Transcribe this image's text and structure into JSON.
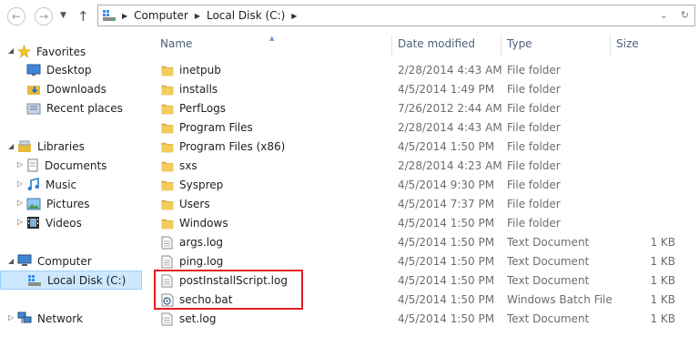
{
  "address": {
    "crumbs": [
      "Computer",
      "Local Disk (C:)"
    ]
  },
  "nav": {
    "favorites": "Favorites",
    "desktop": "Desktop",
    "downloads": "Downloads",
    "recent": "Recent places",
    "libraries": "Libraries",
    "documents": "Documents",
    "music": "Music",
    "pictures": "Pictures",
    "videos": "Videos",
    "computer": "Computer",
    "local_disk": "Local Disk (C:)",
    "network": "Network"
  },
  "columns": {
    "name": "Name",
    "date": "Date modified",
    "type": "Type",
    "size": "Size"
  },
  "files": [
    {
      "name": "inetpub",
      "date": "2/28/2014 4:43 AM",
      "type": "File folder",
      "size": "",
      "icon": "folder-icon"
    },
    {
      "name": "installs",
      "date": "4/5/2014 1:49 PM",
      "type": "File folder",
      "size": "",
      "icon": "folder-icon"
    },
    {
      "name": "PerfLogs",
      "date": "7/26/2012 2:44 AM",
      "type": "File folder",
      "size": "",
      "icon": "folder-icon"
    },
    {
      "name": "Program Files",
      "date": "2/28/2014 4:43 AM",
      "type": "File folder",
      "size": "",
      "icon": "folder-icon"
    },
    {
      "name": "Program Files (x86)",
      "date": "4/5/2014 1:50 PM",
      "type": "File folder",
      "size": "",
      "icon": "folder-icon"
    },
    {
      "name": "sxs",
      "date": "2/28/2014 4:23 AM",
      "type": "File folder",
      "size": "",
      "icon": "folder-icon"
    },
    {
      "name": "Sysprep",
      "date": "4/5/2014 9:30 PM",
      "type": "File folder",
      "size": "",
      "icon": "folder-icon"
    },
    {
      "name": "Users",
      "date": "4/5/2014 7:37 PM",
      "type": "File folder",
      "size": "",
      "icon": "folder-icon"
    },
    {
      "name": "Windows",
      "date": "4/5/2014 1:50 PM",
      "type": "File folder",
      "size": "",
      "icon": "folder-icon"
    },
    {
      "name": "args.log",
      "date": "4/5/2014 1:50 PM",
      "type": "Text Document",
      "size": "1 KB",
      "icon": "text-file-icon"
    },
    {
      "name": "ping.log",
      "date": "4/5/2014 1:50 PM",
      "type": "Text Document",
      "size": "1 KB",
      "icon": "text-file-icon"
    },
    {
      "name": "postInstallScript.log",
      "date": "4/5/2014 1:50 PM",
      "type": "Text Document",
      "size": "1 KB",
      "icon": "text-file-icon"
    },
    {
      "name": "secho.bat",
      "date": "4/5/2014 1:50 PM",
      "type": "Windows Batch File",
      "size": "1 KB",
      "icon": "batch-file-icon"
    },
    {
      "name": "set.log",
      "date": "4/5/2014 1:50 PM",
      "type": "Text Document",
      "size": "1 KB",
      "icon": "text-file-icon"
    }
  ],
  "colors": {
    "selection": "#cce8ff",
    "highlight_box": "#e21d24",
    "folder": "#e8b93d"
  }
}
